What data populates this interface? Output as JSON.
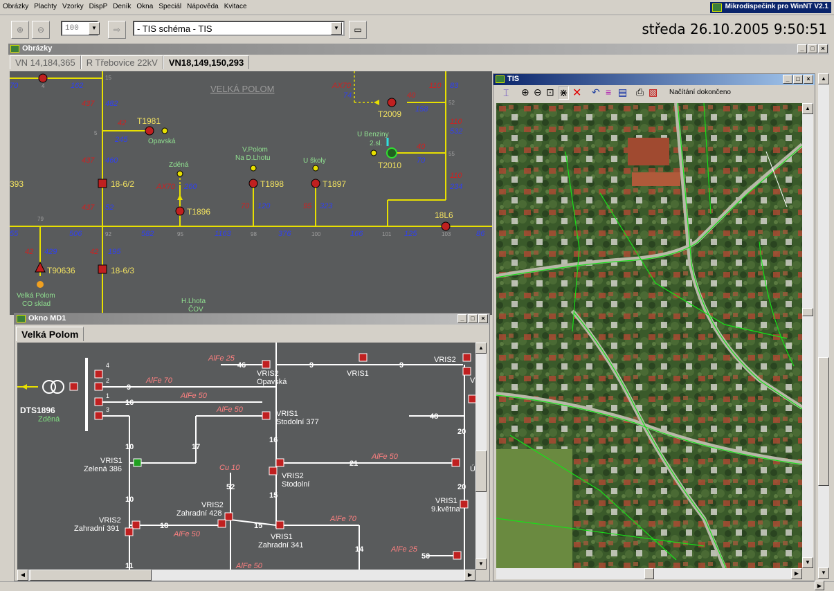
{
  "menu": [
    "Obrázky",
    "Plachty",
    "Vzorky",
    "DispP",
    "Deník",
    "Okna",
    "Speciál",
    "Nápověda",
    "Kvitace"
  ],
  "app_title": "Mikrodispečink pro WinNT V2.1",
  "toolbar": {
    "zoom_value": "100",
    "view_combo": "- TIS schéma - TIS"
  },
  "datetime": "středa  26.10.2005   9:50:51",
  "obrazky": {
    "title": "Obrázky",
    "tabs": [
      "VN 14,184,365",
      "R Třebovice 22kV",
      "VN18,149,150,293"
    ],
    "selected_tab": 2,
    "region_label": "VELKÁ POLOM",
    "labels": {
      "t1981": "T1981",
      "opavska": "Opavská",
      "t2009": "T2009",
      "ubenziny": "U Benziny",
      "sl2": "2.sl.",
      "t2010": "T2010",
      "zdena": "Zděná",
      "vpolom": "V.Polom",
      "nadlhotu": "Na D.Lhotu",
      "uskoly": "U školy",
      "b1862": "18-6/2",
      "t1898": "T1898",
      "t1897": "T1897",
      "t1896": "T1896",
      "l18l6": "18L6",
      "t90636": "T90636",
      "b1863": "18-6/3",
      "vpolom2": "Velká Polom",
      "cosklad": "CO sklad",
      "hlhota": "H.Lhota",
      "cov": "ČOV",
      "n393": "393"
    },
    "numbers_blue": [
      "162",
      "482",
      "245",
      "460",
      "52",
      "260",
      "120",
      "323",
      "70",
      "158",
      "532",
      "234",
      "83",
      "74",
      "506",
      "582",
      "1163",
      "376",
      "166",
      "125",
      "86",
      "429",
      "195",
      "55",
      "70"
    ],
    "numbers_red": [
      "437",
      "42",
      "437",
      "437",
      "AX70",
      "70",
      "95",
      "AX70",
      "40",
      "110",
      "40",
      "110",
      "110",
      "42",
      "42"
    ],
    "numbers_grey": [
      "15",
      "5",
      "79",
      "92",
      "95",
      "98",
      "100",
      "101",
      "103",
      "52",
      "55",
      "4"
    ]
  },
  "md1": {
    "title": "Okno MD1",
    "tab": "Velká Polom",
    "labels": {
      "dts": "DTS1896",
      "zdena": "Zděná",
      "vris2_opavska_a": "VRIS2",
      "vris2_opavska_b": "Opavská",
      "vris1_top": "VRIS1",
      "vris2_right": "VRIS2",
      "vris1_stod_a": "VRIS1",
      "vris1_stod_b": "Stodolní 377",
      "vris1_zel_a": "VRIS1",
      "vris1_zel_b": "Zelená 386",
      "vris2_stod_a": "VRIS2",
      "vris2_stod_b": "Stodolní",
      "vris2_zahr_a": "VRIS2",
      "vris2_zahr_b": "Zahradní 428",
      "vris2_z391_a": "VRIS2",
      "vris2_z391_b": "Zahradní 391",
      "vris1_z341_a": "VRIS1",
      "vris1_z341_b": "Zahradní 341",
      "vris1_9kv_a": "VRIS1",
      "vris1_9kv_b": "9.května",
      "partial_v": "V",
      "partial_u": "Ú"
    },
    "cables": [
      "AlFe 25",
      "AlFe 70",
      "AlFe 50",
      "AlFe 50",
      "Cu 10",
      "AlFe 50",
      "AlFe 50",
      "AlFe 70",
      "AlFe 25",
      "AlFe 50"
    ],
    "lengths": [
      "46",
      "9",
      "9",
      "9",
      "16",
      "48",
      "10",
      "17",
      "16",
      "21",
      "20",
      "52",
      "15",
      "10",
      "18",
      "15",
      "14",
      "20",
      "50",
      "11"
    ],
    "busbar_nums": [
      "4",
      "2",
      "1",
      "3"
    ]
  },
  "tis": {
    "title": "TIS",
    "status": "Načítání dokončeno"
  },
  "colors": {
    "canvas": "#595b5c",
    "feeder": "#e8e000",
    "label_blue": "#2020e0",
    "label_red": "#d02020",
    "label_yellow": "#f0e060",
    "title_active": "#0a246a",
    "map_green": "#18d018"
  }
}
